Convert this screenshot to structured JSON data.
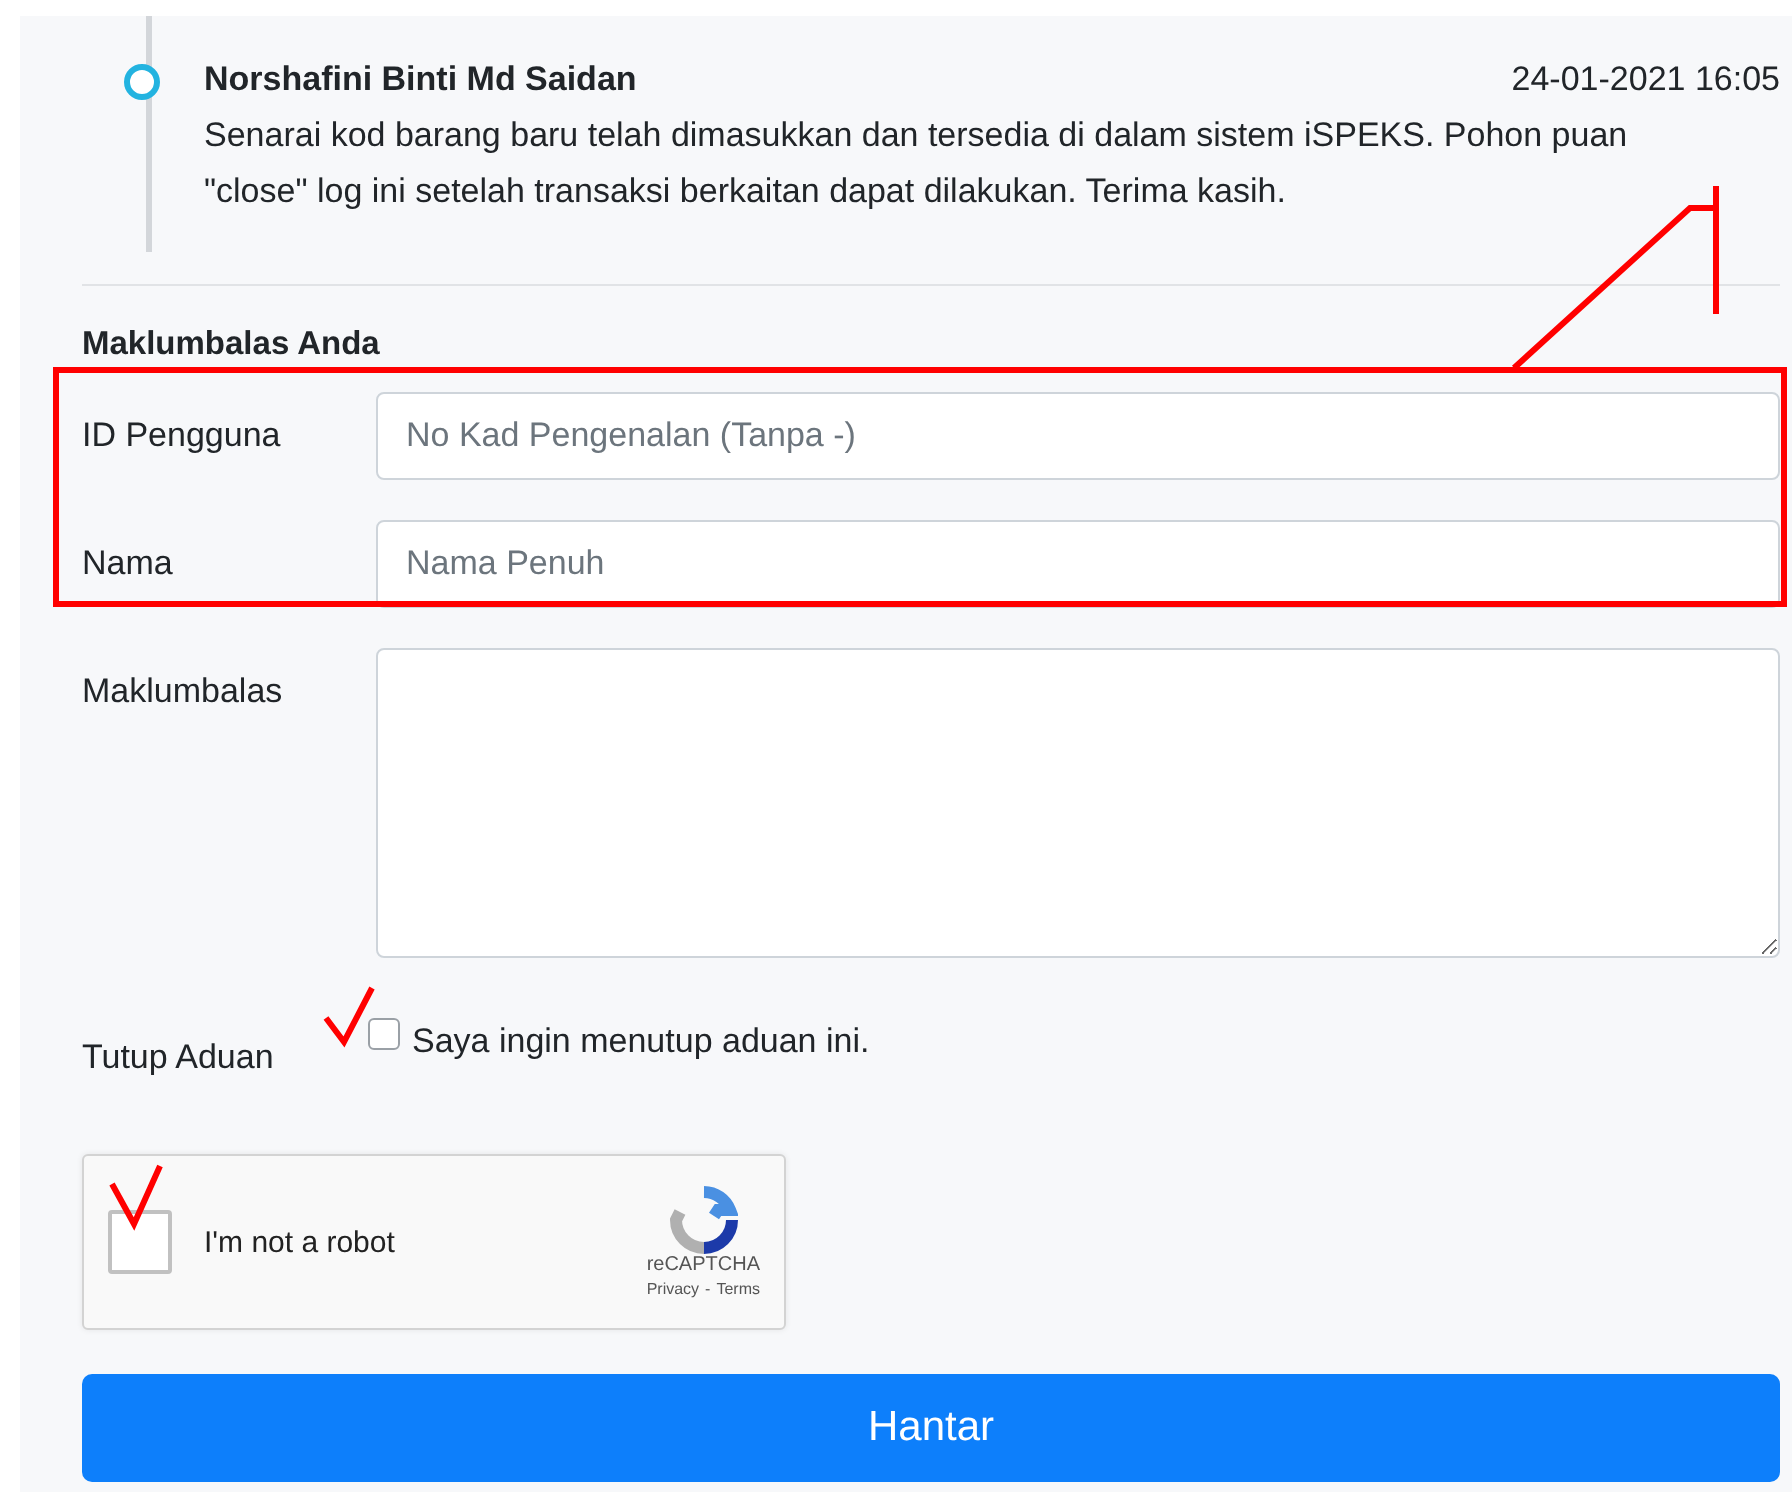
{
  "timeline": [
    {
      "author": "Norshafini Binti Md Saidan",
      "time": "24-01-2021 16:05",
      "message": "Senarai kod barang baru telah dimasukkan dan tersedia di dalam sistem iSPEKS. Pohon puan \"close\" log ini setelah transaksi berkaitan dapat dilakukan. Terima kasih."
    }
  ],
  "form": {
    "heading": "Maklumbalas Anda",
    "fields": [
      {
        "kind": "input",
        "label": "ID Pengguna",
        "placeholder": "No Kad Pengenalan (Tanpa -)"
      },
      {
        "kind": "input",
        "label": "Nama",
        "placeholder": "Nama Penuh"
      },
      {
        "kind": "textarea",
        "label": "Maklumbalas"
      }
    ],
    "close": {
      "label": "Tutup Aduan",
      "option": "Saya ingin menutup aduan ini.",
      "checked": false
    },
    "captcha": {
      "label": "I'm not a robot",
      "brand": "reCAPTCHA",
      "privacy": "Privacy",
      "separator": "-",
      "terms": "Terms",
      "checked": false
    },
    "submit": "Hantar"
  }
}
